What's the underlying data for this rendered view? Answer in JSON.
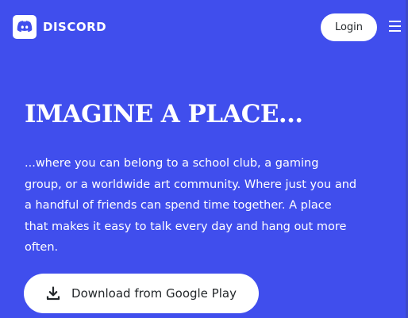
{
  "colors": {
    "background": "#404EED",
    "button_bg": "#FFFFFF",
    "button_text": "#23272A"
  },
  "header": {
    "brand_name": "DISCORD",
    "login_label": "Login",
    "icons": {
      "logo": "discord-logo-icon",
      "menu": "hamburger-menu-icon"
    }
  },
  "hero": {
    "title": "IMAGINE A PLACE...",
    "description": "...where you can belong to a school club, a gaming group, or a worldwide art community. Where just you and a handful of friends can spend time together. A place that makes it easy to talk every day and hang out more often.",
    "download_label": "Download from Google Play",
    "download_icon": "download-icon"
  }
}
